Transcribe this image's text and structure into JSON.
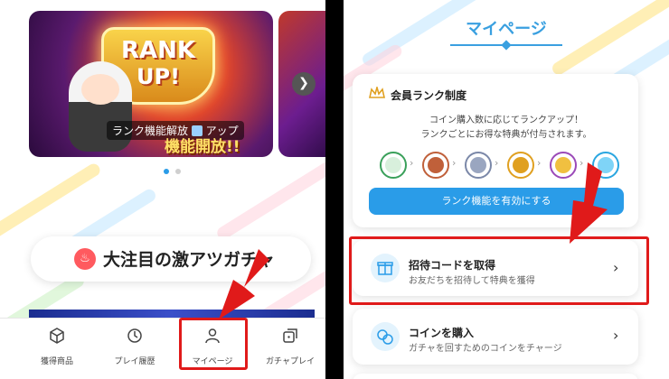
{
  "left_screen": {
    "banner": {
      "badge_line1": "RANK",
      "badge_line2": "UP!",
      "caption": "ランク機能解放",
      "caption_tail": "アップ",
      "subcaption": "機能開放!!"
    },
    "next_icon": "chevron-right-icon",
    "carousel_dots": 2,
    "headline": {
      "icon": "flame-icon",
      "text": "大注目の激アツガチャ"
    },
    "nav": [
      {
        "label": "獲得商品",
        "icon": "box-icon"
      },
      {
        "label": "プレイ履歴",
        "icon": "history-icon"
      },
      {
        "label": "マイページ",
        "icon": "user-icon"
      },
      {
        "label": "ガチャプレイ",
        "icon": "dice-icon"
      }
    ],
    "highlight_color": "#e01a1a"
  },
  "right_screen": {
    "title": "マイページ",
    "rank_card": {
      "title": "会員ランク制度",
      "description_line1": "コイン購入数に応じてランクアップ！",
      "description_line2": "ランクごとにお得な特典が付与されます。",
      "ranks": [
        {
          "name": "sprout-icon",
          "color": "#3aa05a"
        },
        {
          "name": "bronze-medal-icon",
          "color": "#c0603a"
        },
        {
          "name": "silver-medal-icon",
          "color": "#7b88a8"
        },
        {
          "name": "gold-medal-icon",
          "color": "#e0a020"
        },
        {
          "name": "crown-icon",
          "color": "#9b4ab8"
        },
        {
          "name": "diamond-icon",
          "color": "#2aa6e0"
        }
      ],
      "button": "ランク機能を有効にする"
    },
    "menu": [
      {
        "title": "招待コードを取得",
        "subtitle": "お友だちを招待して特典を獲得",
        "icon": "gift-icon"
      },
      {
        "title": "コインを購入",
        "subtitle": "ガチャを回すためのコインをチャージ",
        "icon": "coins-icon"
      }
    ],
    "accent_color": "#2a9ce8"
  }
}
